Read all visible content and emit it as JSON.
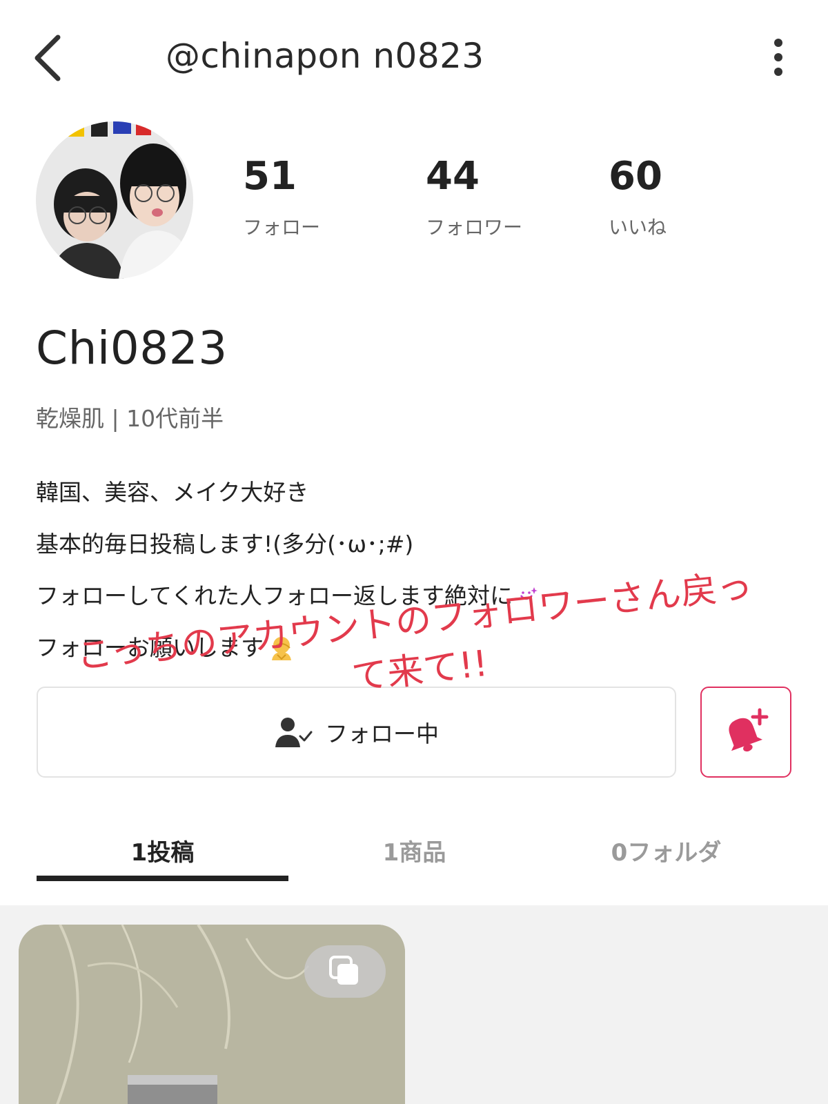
{
  "header": {
    "handle": "@chinapon n0823"
  },
  "stats": [
    {
      "value": "51",
      "label": "フォロー"
    },
    {
      "value": "44",
      "label": "フォロワー"
    },
    {
      "value": "60",
      "label": "いいね"
    }
  ],
  "profile": {
    "display_name": "Chi0823",
    "meta": "乾燥肌 | 10代前半",
    "bio": [
      "韓国、美容、メイク大好き",
      "基本的毎日投稿します!(多分(･ω･;#)",
      "フォローしてくれた人フォロー返します絶対に",
      "フォローお願いします"
    ]
  },
  "actions": {
    "follow_label": "フォロー中"
  },
  "overlay": {
    "line1": "こっちのアカウントのフォロワーさん戻っ",
    "line2": "て来て!!"
  },
  "tabs": [
    {
      "label": "1投稿",
      "active": true
    },
    {
      "label": "1商品",
      "active": false
    },
    {
      "label": "0フォルダ",
      "active": false
    }
  ],
  "colors": {
    "accent": "#e03060",
    "overlay_text": "#e23a4c",
    "text": "#222222",
    "muted": "#666666"
  }
}
